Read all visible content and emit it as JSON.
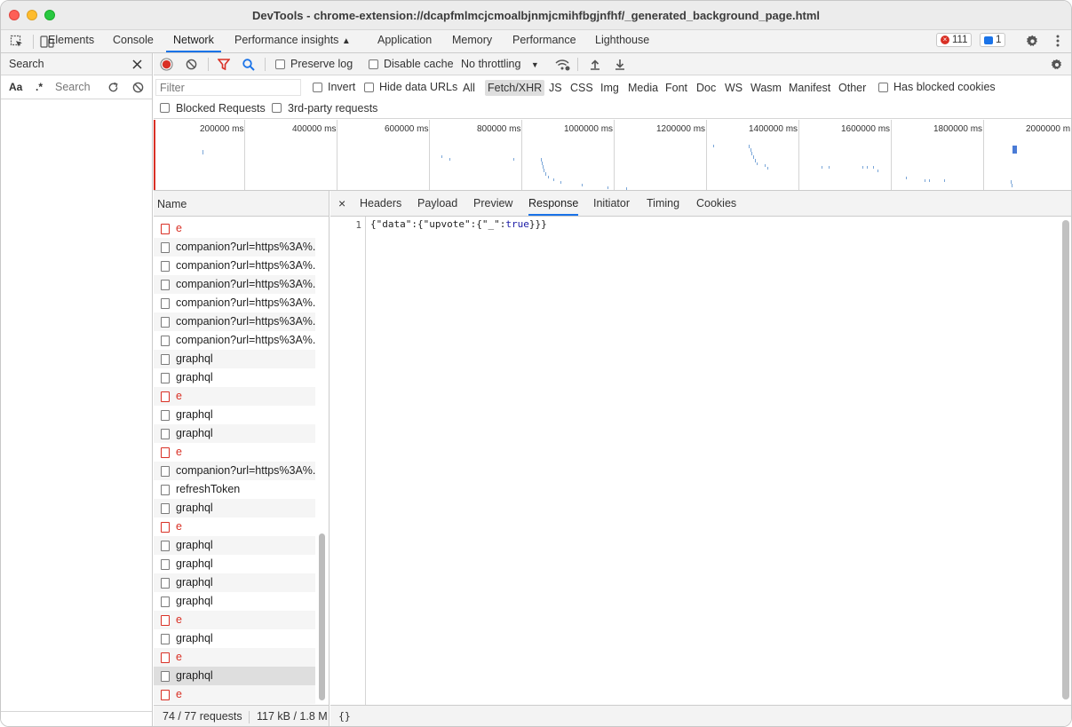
{
  "window": {
    "title": "DevTools - chrome-extension://dcapfmlmcjcmoalbjnmjcmihfbgjnfhf/_generated_background_page.html"
  },
  "main_tabs": [
    "Elements",
    "Console",
    "Network",
    "Performance insights",
    "Application",
    "Memory",
    "Performance",
    "Lighthouse"
  ],
  "badges": {
    "errors": "111",
    "messages": "1"
  },
  "search_panel": {
    "title": "Search",
    "aa": "Aa",
    "regex": ".*",
    "placeholder": "Search"
  },
  "toolbar": {
    "preserve_log": "Preserve log",
    "disable_cache": "Disable cache",
    "throttling": "No throttling"
  },
  "filter": {
    "placeholder": "Filter",
    "invert": "Invert",
    "hide_data_urls": "Hide data URLs",
    "types": [
      "All",
      "Fetch/XHR",
      "JS",
      "CSS",
      "Img",
      "Media",
      "Font",
      "Doc",
      "WS",
      "Wasm",
      "Manifest",
      "Other"
    ],
    "selected_type": "Fetch/XHR",
    "has_blocked_cookies": "Has blocked cookies",
    "blocked_requests": "Blocked Requests",
    "third_party": "3rd-party requests"
  },
  "overview": {
    "ticks": [
      "200000 ms",
      "400000 ms",
      "600000 ms",
      "800000 ms",
      "1000000 ms",
      "1200000 ms",
      "1400000 ms",
      "1600000 ms",
      "1800000 ms",
      "2000000 m"
    ]
  },
  "requests": {
    "header": "Name",
    "rows": [
      {
        "name": "e",
        "error": true
      },
      {
        "name": "companion?url=https%3A%...",
        "error": false
      },
      {
        "name": "companion?url=https%3A%...",
        "error": false
      },
      {
        "name": "companion?url=https%3A%...",
        "error": false
      },
      {
        "name": "companion?url=https%3A%...",
        "error": false
      },
      {
        "name": "companion?url=https%3A%...",
        "error": false
      },
      {
        "name": "companion?url=https%3A%...",
        "error": false
      },
      {
        "name": "graphql",
        "error": false
      },
      {
        "name": "graphql",
        "error": false
      },
      {
        "name": "e",
        "error": true
      },
      {
        "name": "graphql",
        "error": false
      },
      {
        "name": "graphql",
        "error": false
      },
      {
        "name": "e",
        "error": true
      },
      {
        "name": "companion?url=https%3A%...",
        "error": false
      },
      {
        "name": "refreshToken",
        "error": false
      },
      {
        "name": "graphql",
        "error": false
      },
      {
        "name": "e",
        "error": true
      },
      {
        "name": "graphql",
        "error": false
      },
      {
        "name": "graphql",
        "error": false
      },
      {
        "name": "graphql",
        "error": false
      },
      {
        "name": "graphql",
        "error": false
      },
      {
        "name": "e",
        "error": true
      },
      {
        "name": "graphql",
        "error": false
      },
      {
        "name": "e",
        "error": true
      },
      {
        "name": "graphql",
        "error": false,
        "selected": true
      },
      {
        "name": "e",
        "error": true
      }
    ],
    "status_requests": "74 / 77 requests",
    "status_transferred": "117 kB / 1.8 M"
  },
  "detail": {
    "close": "×",
    "tabs": [
      "Headers",
      "Payload",
      "Preview",
      "Response",
      "Initiator",
      "Timing",
      "Cookies"
    ],
    "active_tab": "Response",
    "line_number": "1",
    "response": {
      "p1": "{\"data\":{\"upvote\":{\"_\":",
      "p2": "true",
      "p3": "}}}"
    },
    "pretty_print": "{}"
  }
}
